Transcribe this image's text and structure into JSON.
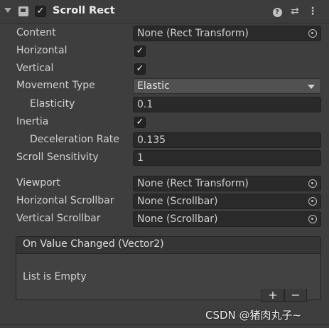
{
  "header": {
    "title": "Scroll Rect",
    "enabled": true,
    "help_icon": "help-icon",
    "presets_icon": "presets-icon",
    "menu_icon": "kebab-menu-icon"
  },
  "properties": {
    "content": {
      "label": "Content",
      "value": "None (Rect Transform)"
    },
    "horizontal": {
      "label": "Horizontal",
      "checked": true
    },
    "vertical": {
      "label": "Vertical",
      "checked": true
    },
    "movement_type": {
      "label": "Movement Type",
      "value": "Elastic"
    },
    "elasticity": {
      "label": "Elasticity",
      "value": "0.1"
    },
    "inertia": {
      "label": "Inertia",
      "checked": true
    },
    "deceleration_rate": {
      "label": "Deceleration Rate",
      "value": "0.135"
    },
    "scroll_sensitivity": {
      "label": "Scroll Sensitivity",
      "value": "1"
    },
    "viewport": {
      "label": "Viewport",
      "value": "None (Rect Transform)"
    },
    "horizontal_scrollbar": {
      "label": "Horizontal Scrollbar",
      "value": "None (Scrollbar)"
    },
    "vertical_scrollbar": {
      "label": "Vertical Scrollbar",
      "value": "None (Scrollbar)"
    }
  },
  "event": {
    "title": "On Value Changed (Vector2)",
    "empty_text": "List is Empty"
  },
  "watermark": "CSDN @猪肉丸子~",
  "colors": {
    "background": "#3e3e3e",
    "field": "#2a2a2a",
    "text": "#d2d2d2"
  }
}
